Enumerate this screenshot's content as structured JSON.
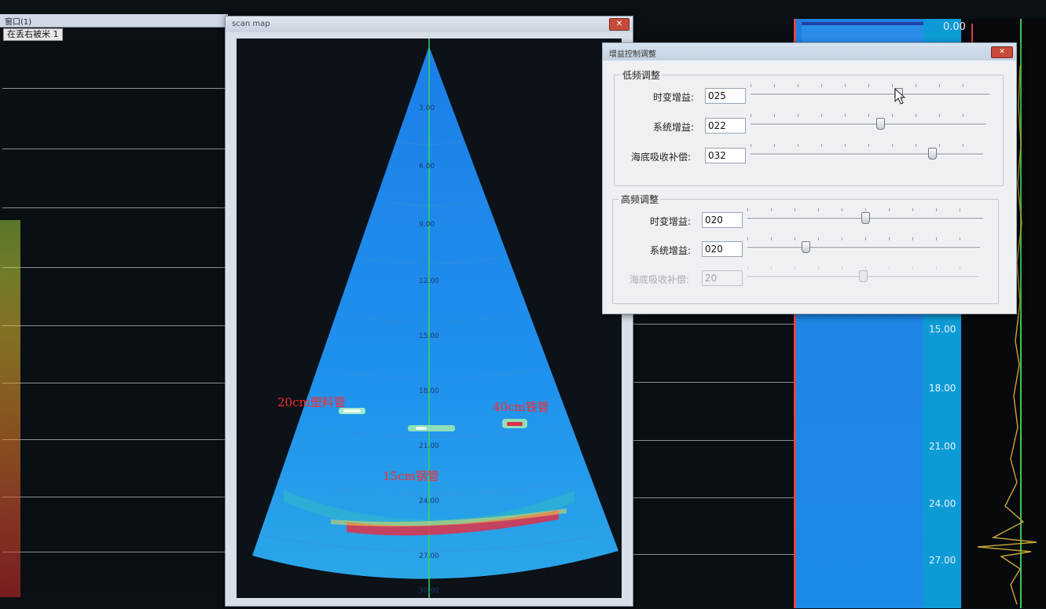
{
  "main_window": {
    "title": "窗口(1)",
    "status_text": "在丢右被米 1"
  },
  "scan_map": {
    "title": "scan map",
    "close_label": "✕",
    "depth_labels": [
      "3.00",
      "6.00",
      "9.00",
      "12.00",
      "15.00",
      "18.00",
      "21.00",
      "24.00",
      "27.00",
      "30.00"
    ],
    "annotations": {
      "left_target": "20cm塑料管",
      "right_target": "40cm铁管",
      "center_target": "15cm钢管"
    }
  },
  "right_panel": {
    "readout_top": "0.00",
    "scale_labels": [
      "15.00",
      "18.00",
      "21.00",
      "24.00",
      "27.00"
    ]
  },
  "gain_dialog": {
    "title": "增益控制调整",
    "close_label": "✕",
    "low_freq": {
      "group_title": "低频调整",
      "rows": [
        {
          "label": "时变增益:",
          "value": "025",
          "level": 0.62
        },
        {
          "label": "系统增益:",
          "value": "022",
          "level": 0.55
        },
        {
          "label": "海底吸收补偿:",
          "value": "032",
          "level": 0.78
        }
      ]
    },
    "high_freq": {
      "group_title": "高频调整",
      "rows": [
        {
          "label": "时变增益:",
          "value": "020",
          "level": 0.5
        },
        {
          "label": "系统增益:",
          "value": "020",
          "level": 0.25
        },
        {
          "label": "海底吸收补偿:",
          "value": "20",
          "level": 0.5,
          "disabled": true
        }
      ]
    }
  },
  "colors": {
    "sonar_blue": "#1e8ef0",
    "target_red": "#e0304a",
    "annotation_red": "#ff2a2a"
  }
}
